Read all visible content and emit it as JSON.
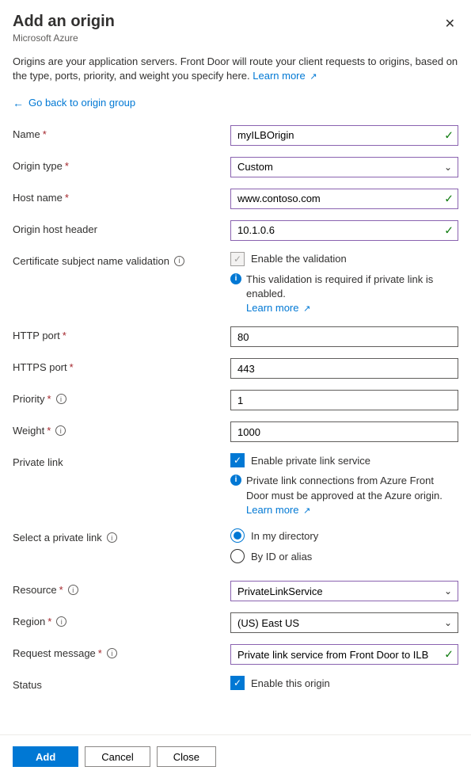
{
  "header": {
    "title": "Add an origin",
    "subtitle": "Microsoft Azure"
  },
  "intro": {
    "text": "Origins are your application servers. Front Door will route your client requests to origins, based on the type, ports, priority, and weight you specify here. ",
    "learn_more": "Learn more"
  },
  "back_link": "Go back to origin group",
  "fields": {
    "name": {
      "label": "Name",
      "value": "myILBOrigin"
    },
    "origin_type": {
      "label": "Origin type",
      "value": "Custom"
    },
    "host_name": {
      "label": "Host name",
      "value": "www.contoso.com"
    },
    "origin_host_header": {
      "label": "Origin host header",
      "value": "10.1.0.6"
    },
    "cert_validation": {
      "label": "Certificate subject name validation",
      "checkbox_label": "Enable the validation",
      "info": "This validation is required if private link is enabled. ",
      "learn_more": "Learn more"
    },
    "http_port": {
      "label": "HTTP port",
      "value": "80"
    },
    "https_port": {
      "label": "HTTPS port",
      "value": "443"
    },
    "priority": {
      "label": "Priority",
      "value": "1"
    },
    "weight": {
      "label": "Weight",
      "value": "1000"
    },
    "private_link": {
      "label": "Private link",
      "checkbox_label": "Enable private link service",
      "info": "Private link connections from Azure Front Door must be approved at the Azure origin. ",
      "learn_more": "Learn more"
    },
    "select_pl": {
      "label": "Select a private link",
      "opt1": "In my directory",
      "opt2": "By ID or alias"
    },
    "resource": {
      "label": "Resource",
      "value": "PrivateLinkService"
    },
    "region": {
      "label": "Region",
      "value": "(US) East US"
    },
    "request_msg": {
      "label": "Request message",
      "value": "Private link service from Front Door to ILB"
    },
    "status": {
      "label": "Status",
      "checkbox_label": "Enable this origin"
    }
  },
  "footer": {
    "add": "Add",
    "cancel": "Cancel",
    "close": "Close"
  }
}
